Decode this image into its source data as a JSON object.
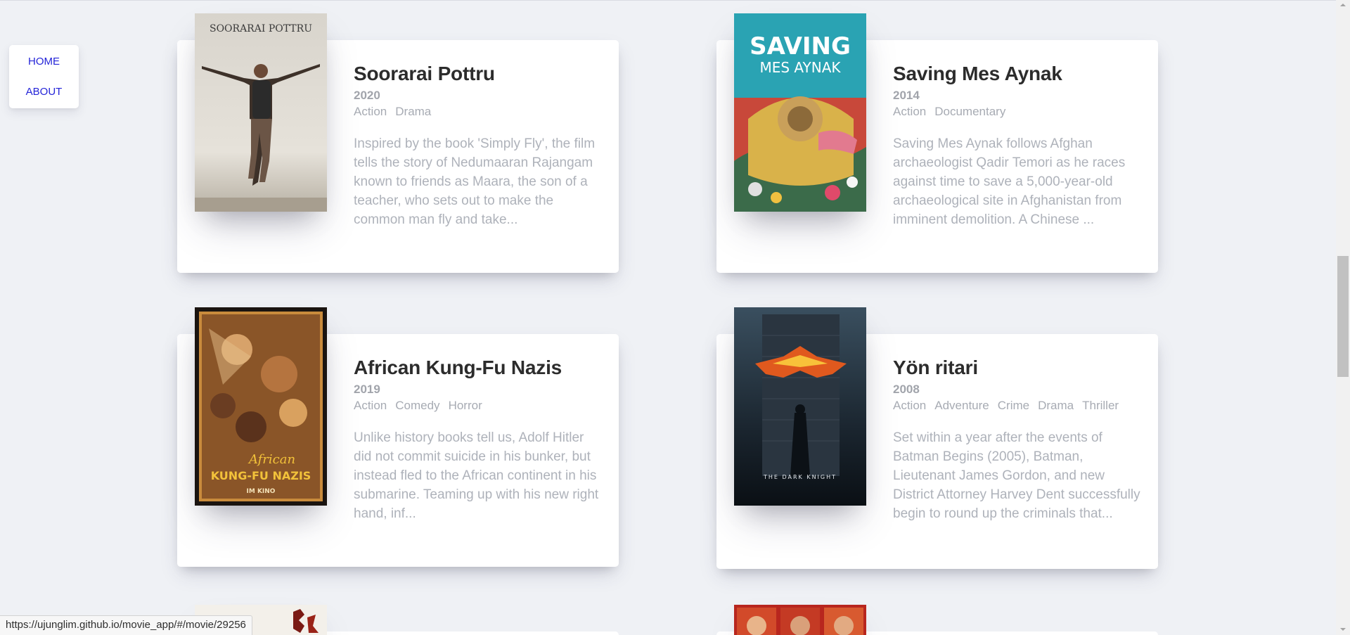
{
  "nav": {
    "home_label": "HOME",
    "about_label": "ABOUT"
  },
  "movies": [
    {
      "title": "Soorarai Pottru",
      "year": "2020",
      "genres": [
        "Action",
        "Drama"
      ],
      "summary": "Inspired by the book 'Simply Fly', the film tells the story of Nedumaaran Rajangam known to friends as Maara, the son of a teacher, who sets out to make the common man fly and take...",
      "poster_text": "SOORARAI POTTRU"
    },
    {
      "title": "Saving Mes Aynak",
      "year": "2014",
      "genres": [
        "Action",
        "Documentary"
      ],
      "summary": "Saving Mes Aynak follows Afghan archaeologist Qadir Temori as he races against time to save a 5,000-year-old archaeological site in Afghanistan from imminent demolition. A Chinese ...",
      "poster_text_1": "SAVING",
      "poster_text_2": "MES AYNAK"
    },
    {
      "title": "African Kung-Fu Nazis",
      "year": "2019",
      "genres": [
        "Action",
        "Comedy",
        "Horror"
      ],
      "summary": "Unlike history books tell us, Adolf Hitler did not commit suicide in his bunker, but instead fled to the African continent in his submarine. Teaming up with his new right hand, inf...",
      "poster_text_1": "African",
      "poster_text_2": "KUNG-FU NAZIS",
      "poster_text_3": "IM KINO"
    },
    {
      "title": "Yön ritari",
      "year": "2008",
      "genres": [
        "Action",
        "Adventure",
        "Crime",
        "Drama",
        "Thriller"
      ],
      "summary": "Set within a year after the events of Batman Begins (2005), Batman, Lieutenant James Gordon, and new District Attorney Harvey Dent successfully begin to round up the criminals that...",
      "poster_text": "THE DARK KNIGHT"
    }
  ],
  "status_url": "https://ujunglim.github.io/movie_app/#/movie/29256",
  "colors": {
    "background": "#eff1f5",
    "nav_link": "#2424d8",
    "title": "#2c2c2c",
    "muted": "#a7abb3"
  }
}
